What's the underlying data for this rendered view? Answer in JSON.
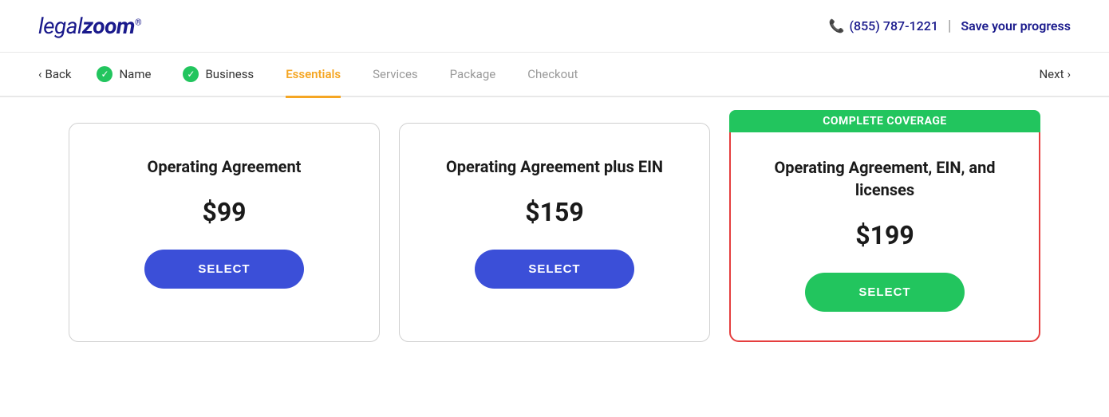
{
  "header": {
    "logo_legal": "legal",
    "logo_zoom": "zoom",
    "logo_trademark": "®",
    "phone_label": "(855) 787-1221",
    "save_label": "Save your progress"
  },
  "nav": {
    "back_label": "Back",
    "next_label": "Next",
    "steps": [
      {
        "id": "name",
        "label": "Name",
        "state": "completed"
      },
      {
        "id": "business",
        "label": "Business",
        "state": "completed"
      },
      {
        "id": "essentials",
        "label": "Essentials",
        "state": "active"
      },
      {
        "id": "services",
        "label": "Services",
        "state": "inactive"
      },
      {
        "id": "package",
        "label": "Package",
        "state": "inactive"
      },
      {
        "id": "checkout",
        "label": "Checkout",
        "state": "inactive"
      }
    ]
  },
  "cards": [
    {
      "id": "card-1",
      "title": "Operating Agreement",
      "price": "$99",
      "select_label": "SELECT",
      "featured": false,
      "badge": null,
      "button_color": "blue"
    },
    {
      "id": "card-2",
      "title": "Operating Agreement plus EIN",
      "price": "$159",
      "select_label": "SELECT",
      "featured": false,
      "badge": null,
      "button_color": "blue"
    },
    {
      "id": "card-3",
      "title": "Operating Agreement, EIN, and licenses",
      "price": "$199",
      "select_label": "SELECT",
      "featured": true,
      "badge": "COMPLETE COVERAGE",
      "button_color": "green"
    }
  ]
}
